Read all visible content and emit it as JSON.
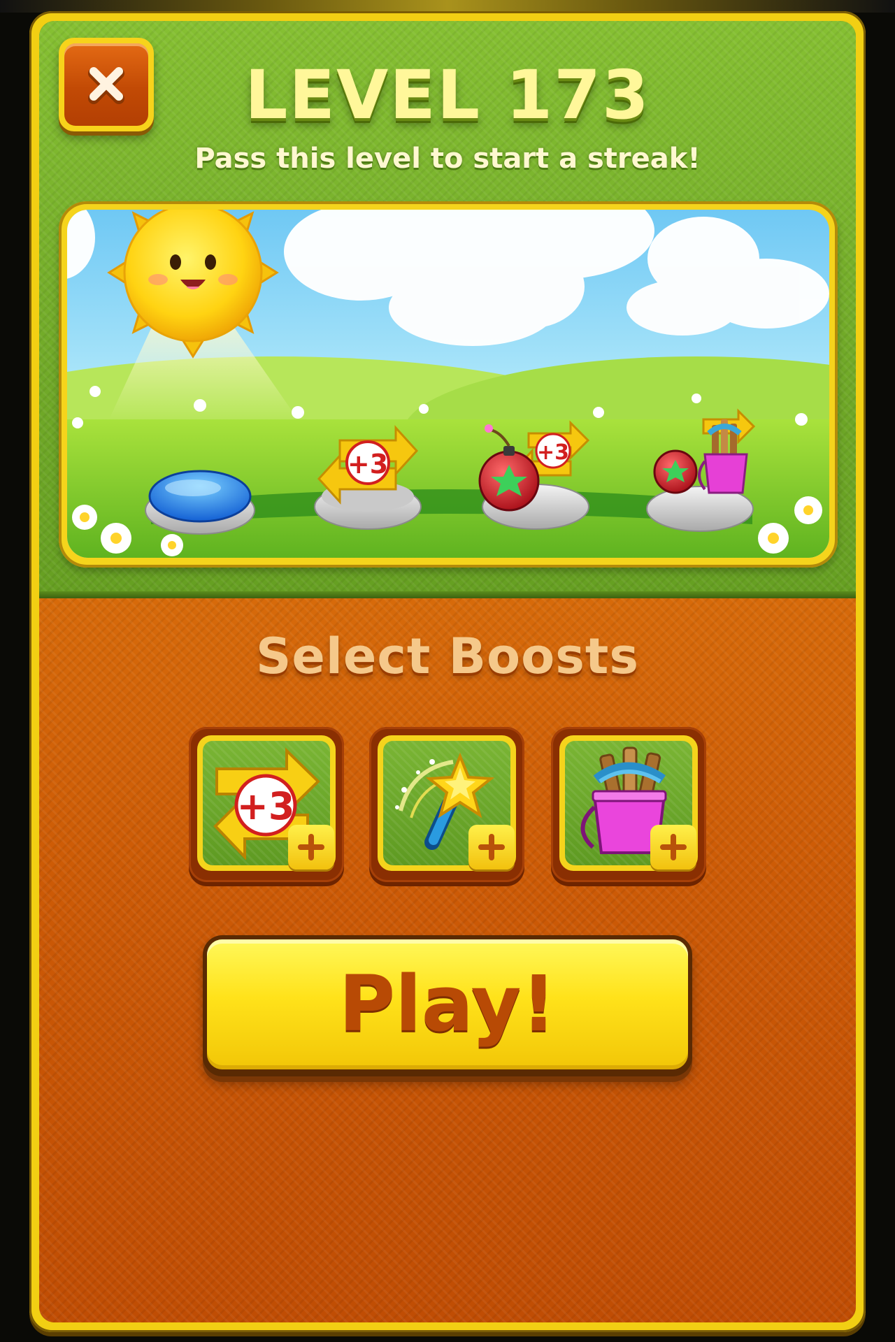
{
  "dialog": {
    "title": "LEVEL 173",
    "subtitle": "Pass this level to start a streak!"
  },
  "close_button": {
    "icon": "close-icon"
  },
  "streak_preview": {
    "pedestals": [
      {
        "reward": "none",
        "icon": "blue-button-icon"
      },
      {
        "reward": "extra-moves",
        "icon": "plus-three-moves-icon",
        "badge": "+3"
      },
      {
        "reward": "bomb-and-moves",
        "icon": "bomb-icon",
        "badge": "+3"
      },
      {
        "reward": "bomb-and-bucket",
        "icon": "bucket-icon"
      }
    ]
  },
  "boosts": {
    "heading": "Select Boosts",
    "items": [
      {
        "name": "extra-moves",
        "icon": "plus-three-moves-icon",
        "badge": "+3",
        "action_icon": "plus-icon"
      },
      {
        "name": "magic-wand",
        "icon": "magic-wand-icon",
        "action_icon": "plus-icon"
      },
      {
        "name": "bucket-of-sticks",
        "icon": "bucket-icon",
        "action_icon": "plus-icon"
      }
    ]
  },
  "play_button": {
    "label": "Play!"
  },
  "colors": {
    "gold_rim": "#f5d41c",
    "green_header": "#74ad2a",
    "orange_body": "#cc5a06",
    "play_text": "#b84a05"
  }
}
